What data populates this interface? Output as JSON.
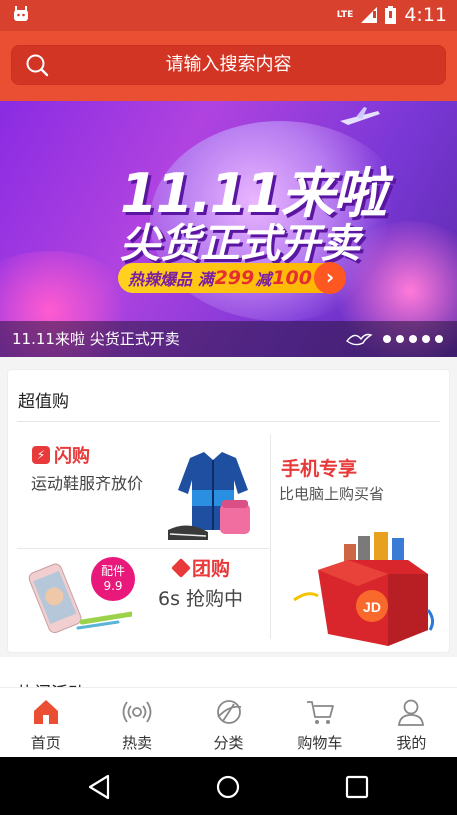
{
  "status_bar": {
    "time": "4:11",
    "network": "LTE"
  },
  "search": {
    "placeholder": "请输入搜索内容"
  },
  "banner": {
    "headline_1": "11.11来啦",
    "headline_2": "尖货正式开卖",
    "promo_prefix": "热辣爆品 满",
    "promo_amount_1": "299",
    "promo_mid": "减",
    "promo_amount_2": "100",
    "caption": "11.11来啦 尖货正式开卖",
    "dots_count": 5
  },
  "value_section": {
    "title": "超值购",
    "flash": {
      "label": "闪购",
      "badge": "⚡",
      "subtitle": "运动鞋服齐放价"
    },
    "phone_exclusive": {
      "label": "手机专享",
      "subtitle": "比电脑上购买省"
    },
    "accessory_badge": {
      "line1": "配件",
      "line2": "9.9"
    },
    "group_buy": {
      "label": "团购",
      "subtitle": "6s 抢购中"
    },
    "gift_box_text": "JD"
  },
  "next_section": {
    "title": "热门活动"
  },
  "tabs": [
    {
      "label": "首页",
      "icon": "home-icon",
      "active": true
    },
    {
      "label": "热卖",
      "icon": "broadcast-icon",
      "active": false
    },
    {
      "label": "分类",
      "icon": "category-icon",
      "active": false
    },
    {
      "label": "购物车",
      "icon": "cart-icon",
      "active": false
    },
    {
      "label": "我的",
      "icon": "user-icon",
      "active": false
    }
  ],
  "colors": {
    "primary": "#ea4f34",
    "accent_red": "#e83a3a",
    "status_bar": "#d9412f"
  }
}
